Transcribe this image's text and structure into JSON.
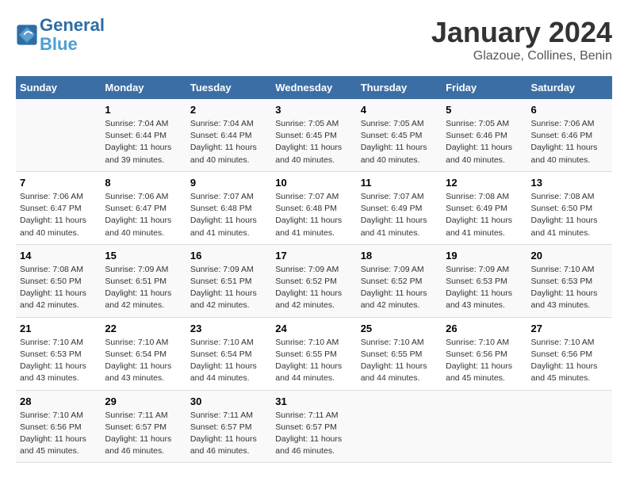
{
  "header": {
    "logo_line1": "General",
    "logo_line2": "Blue",
    "title": "January 2024",
    "subtitle": "Glazoue, Collines, Benin"
  },
  "columns": [
    "Sunday",
    "Monday",
    "Tuesday",
    "Wednesday",
    "Thursday",
    "Friday",
    "Saturday"
  ],
  "weeks": [
    [
      {
        "day": "",
        "sunrise": "",
        "sunset": "",
        "daylight": ""
      },
      {
        "day": "1",
        "sunrise": "Sunrise: 7:04 AM",
        "sunset": "Sunset: 6:44 PM",
        "daylight": "Daylight: 11 hours and 39 minutes."
      },
      {
        "day": "2",
        "sunrise": "Sunrise: 7:04 AM",
        "sunset": "Sunset: 6:44 PM",
        "daylight": "Daylight: 11 hours and 40 minutes."
      },
      {
        "day": "3",
        "sunrise": "Sunrise: 7:05 AM",
        "sunset": "Sunset: 6:45 PM",
        "daylight": "Daylight: 11 hours and 40 minutes."
      },
      {
        "day": "4",
        "sunrise": "Sunrise: 7:05 AM",
        "sunset": "Sunset: 6:45 PM",
        "daylight": "Daylight: 11 hours and 40 minutes."
      },
      {
        "day": "5",
        "sunrise": "Sunrise: 7:05 AM",
        "sunset": "Sunset: 6:46 PM",
        "daylight": "Daylight: 11 hours and 40 minutes."
      },
      {
        "day": "6",
        "sunrise": "Sunrise: 7:06 AM",
        "sunset": "Sunset: 6:46 PM",
        "daylight": "Daylight: 11 hours and 40 minutes."
      }
    ],
    [
      {
        "day": "7",
        "sunrise": "Sunrise: 7:06 AM",
        "sunset": "Sunset: 6:47 PM",
        "daylight": "Daylight: 11 hours and 40 minutes."
      },
      {
        "day": "8",
        "sunrise": "Sunrise: 7:06 AM",
        "sunset": "Sunset: 6:47 PM",
        "daylight": "Daylight: 11 hours and 40 minutes."
      },
      {
        "day": "9",
        "sunrise": "Sunrise: 7:07 AM",
        "sunset": "Sunset: 6:48 PM",
        "daylight": "Daylight: 11 hours and 41 minutes."
      },
      {
        "day": "10",
        "sunrise": "Sunrise: 7:07 AM",
        "sunset": "Sunset: 6:48 PM",
        "daylight": "Daylight: 11 hours and 41 minutes."
      },
      {
        "day": "11",
        "sunrise": "Sunrise: 7:07 AM",
        "sunset": "Sunset: 6:49 PM",
        "daylight": "Daylight: 11 hours and 41 minutes."
      },
      {
        "day": "12",
        "sunrise": "Sunrise: 7:08 AM",
        "sunset": "Sunset: 6:49 PM",
        "daylight": "Daylight: 11 hours and 41 minutes."
      },
      {
        "day": "13",
        "sunrise": "Sunrise: 7:08 AM",
        "sunset": "Sunset: 6:50 PM",
        "daylight": "Daylight: 11 hours and 41 minutes."
      }
    ],
    [
      {
        "day": "14",
        "sunrise": "Sunrise: 7:08 AM",
        "sunset": "Sunset: 6:50 PM",
        "daylight": "Daylight: 11 hours and 42 minutes."
      },
      {
        "day": "15",
        "sunrise": "Sunrise: 7:09 AM",
        "sunset": "Sunset: 6:51 PM",
        "daylight": "Daylight: 11 hours and 42 minutes."
      },
      {
        "day": "16",
        "sunrise": "Sunrise: 7:09 AM",
        "sunset": "Sunset: 6:51 PM",
        "daylight": "Daylight: 11 hours and 42 minutes."
      },
      {
        "day": "17",
        "sunrise": "Sunrise: 7:09 AM",
        "sunset": "Sunset: 6:52 PM",
        "daylight": "Daylight: 11 hours and 42 minutes."
      },
      {
        "day": "18",
        "sunrise": "Sunrise: 7:09 AM",
        "sunset": "Sunset: 6:52 PM",
        "daylight": "Daylight: 11 hours and 42 minutes."
      },
      {
        "day": "19",
        "sunrise": "Sunrise: 7:09 AM",
        "sunset": "Sunset: 6:53 PM",
        "daylight": "Daylight: 11 hours and 43 minutes."
      },
      {
        "day": "20",
        "sunrise": "Sunrise: 7:10 AM",
        "sunset": "Sunset: 6:53 PM",
        "daylight": "Daylight: 11 hours and 43 minutes."
      }
    ],
    [
      {
        "day": "21",
        "sunrise": "Sunrise: 7:10 AM",
        "sunset": "Sunset: 6:53 PM",
        "daylight": "Daylight: 11 hours and 43 minutes."
      },
      {
        "day": "22",
        "sunrise": "Sunrise: 7:10 AM",
        "sunset": "Sunset: 6:54 PM",
        "daylight": "Daylight: 11 hours and 43 minutes."
      },
      {
        "day": "23",
        "sunrise": "Sunrise: 7:10 AM",
        "sunset": "Sunset: 6:54 PM",
        "daylight": "Daylight: 11 hours and 44 minutes."
      },
      {
        "day": "24",
        "sunrise": "Sunrise: 7:10 AM",
        "sunset": "Sunset: 6:55 PM",
        "daylight": "Daylight: 11 hours and 44 minutes."
      },
      {
        "day": "25",
        "sunrise": "Sunrise: 7:10 AM",
        "sunset": "Sunset: 6:55 PM",
        "daylight": "Daylight: 11 hours and 44 minutes."
      },
      {
        "day": "26",
        "sunrise": "Sunrise: 7:10 AM",
        "sunset": "Sunset: 6:56 PM",
        "daylight": "Daylight: 11 hours and 45 minutes."
      },
      {
        "day": "27",
        "sunrise": "Sunrise: 7:10 AM",
        "sunset": "Sunset: 6:56 PM",
        "daylight": "Daylight: 11 hours and 45 minutes."
      }
    ],
    [
      {
        "day": "28",
        "sunrise": "Sunrise: 7:10 AM",
        "sunset": "Sunset: 6:56 PM",
        "daylight": "Daylight: 11 hours and 45 minutes."
      },
      {
        "day": "29",
        "sunrise": "Sunrise: 7:11 AM",
        "sunset": "Sunset: 6:57 PM",
        "daylight": "Daylight: 11 hours and 46 minutes."
      },
      {
        "day": "30",
        "sunrise": "Sunrise: 7:11 AM",
        "sunset": "Sunset: 6:57 PM",
        "daylight": "Daylight: 11 hours and 46 minutes."
      },
      {
        "day": "31",
        "sunrise": "Sunrise: 7:11 AM",
        "sunset": "Sunset: 6:57 PM",
        "daylight": "Daylight: 11 hours and 46 minutes."
      },
      {
        "day": "",
        "sunrise": "",
        "sunset": "",
        "daylight": ""
      },
      {
        "day": "",
        "sunrise": "",
        "sunset": "",
        "daylight": ""
      },
      {
        "day": "",
        "sunrise": "",
        "sunset": "",
        "daylight": ""
      }
    ]
  ]
}
